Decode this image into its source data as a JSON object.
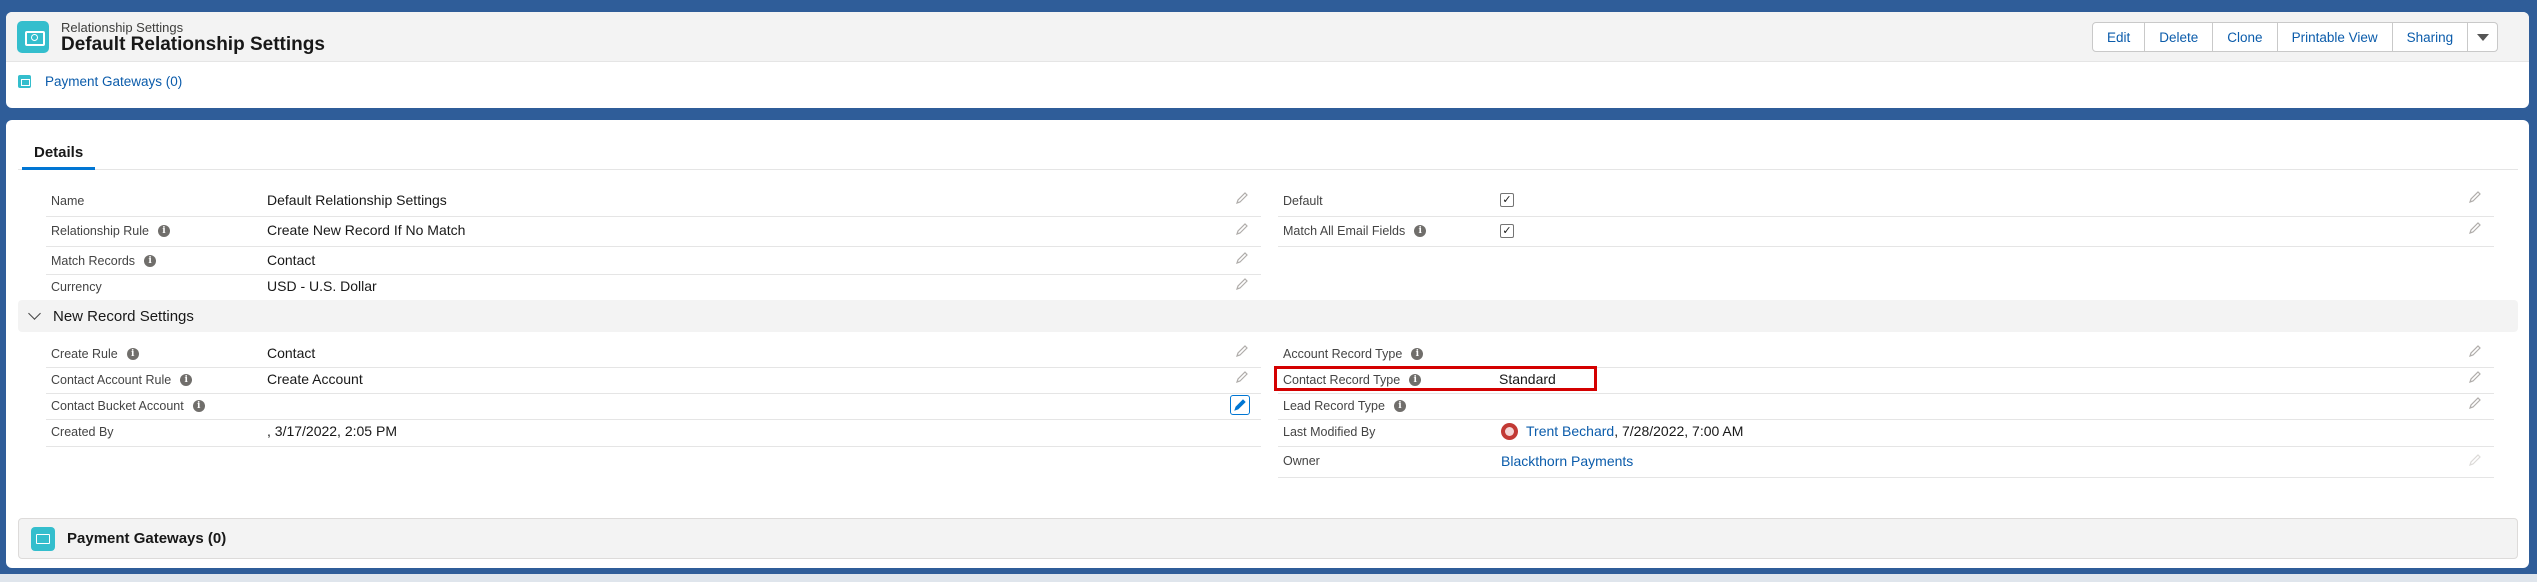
{
  "header": {
    "object_type": "Relationship Settings",
    "record_title": "Default Relationship Settings",
    "actions": [
      "Edit",
      "Delete",
      "Clone",
      "Printable View",
      "Sharing"
    ],
    "related_link": "Payment Gateways (0)"
  },
  "tabs": [
    "Details"
  ],
  "details": {
    "name_label": "Name",
    "name_value": "Default Relationship Settings",
    "relationship_rule_label": "Relationship Rule",
    "relationship_rule_value": "Create New Record If No Match",
    "match_records_label": "Match Records",
    "match_records_value": "Contact",
    "currency_label": "Currency",
    "currency_value": "USD - U.S. Dollar",
    "default_label": "Default",
    "default_checked": true,
    "match_all_email_label": "Match All Email Fields",
    "match_all_email_checked": true
  },
  "new_record_section": {
    "title": "New Record Settings",
    "create_rule_label": "Create Rule",
    "create_rule_value": "Contact",
    "contact_account_rule_label": "Contact Account Rule",
    "contact_account_rule_value": "Create Account",
    "contact_bucket_account_label": "Contact Bucket Account",
    "created_by_label": "Created By",
    "created_by_value": ", 3/17/2022, 2:05 PM",
    "account_record_type_label": "Account Record Type",
    "contact_record_type_label": "Contact Record Type",
    "contact_record_type_value": "Standard",
    "lead_record_type_label": "Lead Record Type",
    "last_modified_by_label": "Last Modified By",
    "last_modified_by_user": "Trent Bechard",
    "last_modified_by_date": ", 7/28/2022, 7:00 AM",
    "owner_label": "Owner",
    "owner_value": "Blackthorn Payments"
  },
  "related_list": {
    "title": "Payment Gateways (0)"
  },
  "colors": {
    "accent": "#0176d3",
    "link": "#0b5cab",
    "object_icon": "#34becd",
    "highlight": "#d40000"
  }
}
